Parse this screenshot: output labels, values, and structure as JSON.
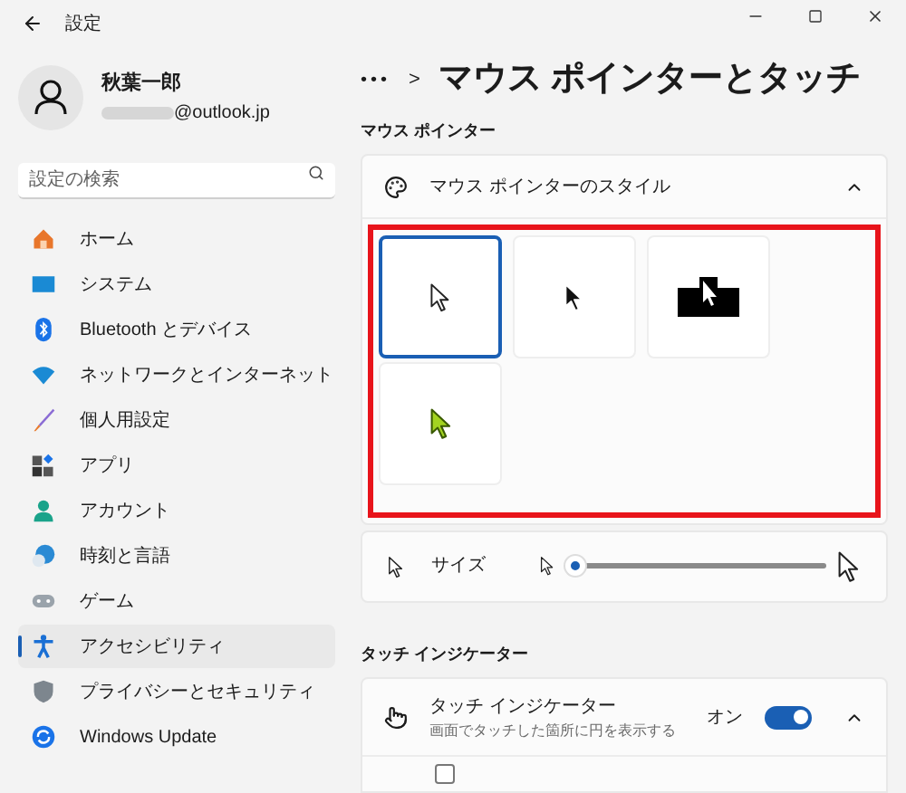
{
  "window": {
    "title": "設定"
  },
  "user": {
    "name": "秋葉一郎",
    "email": "@outlook.jp"
  },
  "search": {
    "placeholder": "設定の検索"
  },
  "sidebar": {
    "items": [
      {
        "label": "ホーム",
        "kind": "home",
        "selected": false
      },
      {
        "label": "システム",
        "kind": "system",
        "selected": false
      },
      {
        "label": "Bluetooth とデバイス",
        "kind": "bluetooth",
        "selected": false
      },
      {
        "label": "ネットワークとインターネット",
        "kind": "network",
        "selected": false
      },
      {
        "label": "個人用設定",
        "kind": "brush",
        "selected": false
      },
      {
        "label": "アプリ",
        "kind": "apps",
        "selected": false
      },
      {
        "label": "アカウント",
        "kind": "account",
        "selected": false
      },
      {
        "label": "時刻と言語",
        "kind": "time",
        "selected": false
      },
      {
        "label": "ゲーム",
        "kind": "game",
        "selected": false
      },
      {
        "label": "アクセシビリティ",
        "kind": "accessibility",
        "selected": true
      },
      {
        "label": "プライバシーとセキュリティ",
        "kind": "shield",
        "selected": false
      },
      {
        "label": "Windows Update",
        "kind": "update",
        "selected": false
      }
    ]
  },
  "breadcrumb": {
    "more": "•••",
    "separator": ">",
    "title": "マウス ポインターとタッチ"
  },
  "mouse_section": {
    "heading": "マウス ポインター",
    "style_card": {
      "label": "マウス ポインターのスタイル",
      "expanded": true,
      "styles": [
        {
          "kind": "white",
          "selected": true
        },
        {
          "kind": "black",
          "selected": false
        },
        {
          "kind": "inverted",
          "selected": false
        },
        {
          "kind": "custom",
          "selected": false
        }
      ]
    },
    "size": {
      "label": "サイズ",
      "level": 0.0
    }
  },
  "touch_section": {
    "heading": "タッチ インジケーター",
    "indicator": {
      "label": "タッチ インジケーター",
      "description": "画面でタッチした箇所に円を表示する",
      "state_text": "オン",
      "on": true,
      "expanded": true
    },
    "option": {
      "checked": false
    }
  }
}
